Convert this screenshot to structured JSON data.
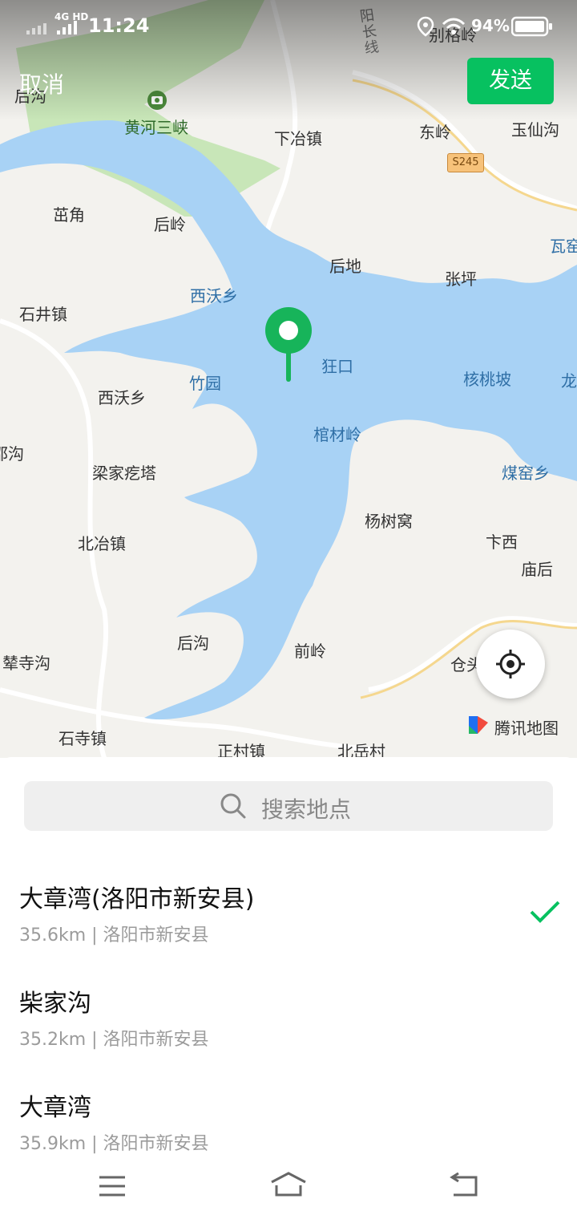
{
  "status_bar": {
    "network": "4G HD",
    "time": "11:24",
    "battery": "94%",
    "top_right_place": "别格岭"
  },
  "header": {
    "cancel_label": "取消",
    "send_label": "发送"
  },
  "map": {
    "attribution": "腾讯地图",
    "road_badge": "S245",
    "road_name": "阳长线",
    "labels": {
      "houyan_tl": "后沟",
      "huanghe": "黄河三峡",
      "xiayezhen": "下冶镇",
      "dongling": "东岭",
      "yuxiangou": "玉仙沟",
      "zhujiao": "茁角",
      "houling": "后岭",
      "waku": "瓦窑",
      "houdi": "后地",
      "zhangping": "张坪",
      "shijingzhen": "石井镇",
      "xiwoxiang_w": "西沃乡",
      "kuangkou": "狂口",
      "hetaopo": "核桃坡",
      "long": "龙",
      "zhuyuan": "竹园",
      "xiwoxiang": "西沃乡",
      "guancailing": "棺材岭",
      "ab": "邵沟",
      "liangjia": "梁家疙塔",
      "meiyaoxiang": "煤窑乡",
      "yangshuwo": "杨树窝",
      "beiyezhen": "北冶镇",
      "bianxi": "卞西",
      "miaohou": "庙后",
      "hougou": "后沟",
      "qianling": "前岭",
      "cangtou": "仓头",
      "nisigou": "辇寺沟",
      "shisizhen": "石寺镇",
      "zhengcun": "正村镇",
      "beiyuecun": "北岳村"
    }
  },
  "search": {
    "placeholder": "搜索地点"
  },
  "results": [
    {
      "title": "大章湾(洛阳市新安县)",
      "subtitle": "35.6km | 洛阳市新安县",
      "selected": true
    },
    {
      "title": "柴家沟",
      "subtitle": "35.2km | 洛阳市新安县",
      "selected": false
    },
    {
      "title": "大章湾",
      "subtitle": "35.9km | 洛阳市新安县",
      "selected": false
    }
  ],
  "colors": {
    "accent": "#07c160",
    "water": "#a8d2f5",
    "park": "#c8e6b8",
    "land": "#f3f2ee"
  },
  "icons": [
    "signal-icon",
    "location-pin-icon",
    "wifi-icon",
    "battery-icon",
    "camera-poi-icon",
    "map-marker-icon",
    "locate-crosshair-icon",
    "tencent-maps-logo-icon",
    "search-icon",
    "checkmark-icon",
    "menu-icon",
    "home-icon",
    "back-icon"
  ]
}
